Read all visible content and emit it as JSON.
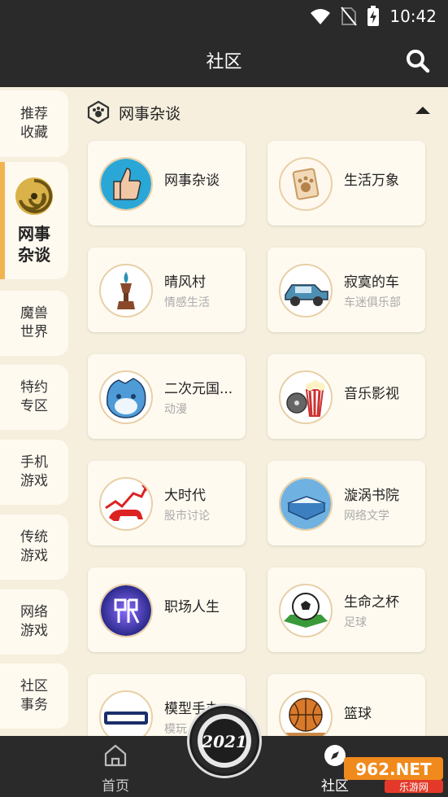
{
  "status": {
    "time": "10:42",
    "icons": [
      "wifi-icon",
      "no-sim-icon",
      "battery-charging-icon"
    ]
  },
  "header": {
    "title": "社区",
    "search_icon": "search-icon"
  },
  "sidebar": {
    "items": [
      {
        "label": "推荐收藏"
      },
      {
        "label": "网事杂谈",
        "active": true
      },
      {
        "label": "魔兽世界"
      },
      {
        "label": "特约专区"
      },
      {
        "label": "手机游戏"
      },
      {
        "label": "传统游戏"
      },
      {
        "label": "网络游戏"
      },
      {
        "label": "社区事务"
      }
    ]
  },
  "section": {
    "title": "网事杂谈"
  },
  "cards": [
    {
      "name": "网事杂谈",
      "sub": ""
    },
    {
      "name": "生活万象",
      "sub": ""
    },
    {
      "name": "晴风村",
      "sub": "情感生活"
    },
    {
      "name": "寂寞的车",
      "sub": "车迷俱乐部"
    },
    {
      "name": "二次元国...",
      "sub": "动漫"
    },
    {
      "name": "音乐影视",
      "sub": ""
    },
    {
      "name": "大时代",
      "sub": "股市讨论"
    },
    {
      "name": "漩涡书院",
      "sub": "网络文学"
    },
    {
      "name": "职场人生",
      "sub": ""
    },
    {
      "name": "生命之杯",
      "sub": "足球"
    },
    {
      "name": "模型手办",
      "sub": "模玩"
    },
    {
      "name": "篮球",
      "sub": ""
    }
  ],
  "bottom_nav": {
    "home": "首页",
    "community": "社区",
    "badge_year": "2021"
  },
  "watermark": {
    "text": "962.NET",
    "sub": "乐游网"
  },
  "colors": {
    "bar": "#2b2a2a",
    "bg": "#f6efde",
    "card": "#fffaf0",
    "accent": "#f2b44f"
  }
}
